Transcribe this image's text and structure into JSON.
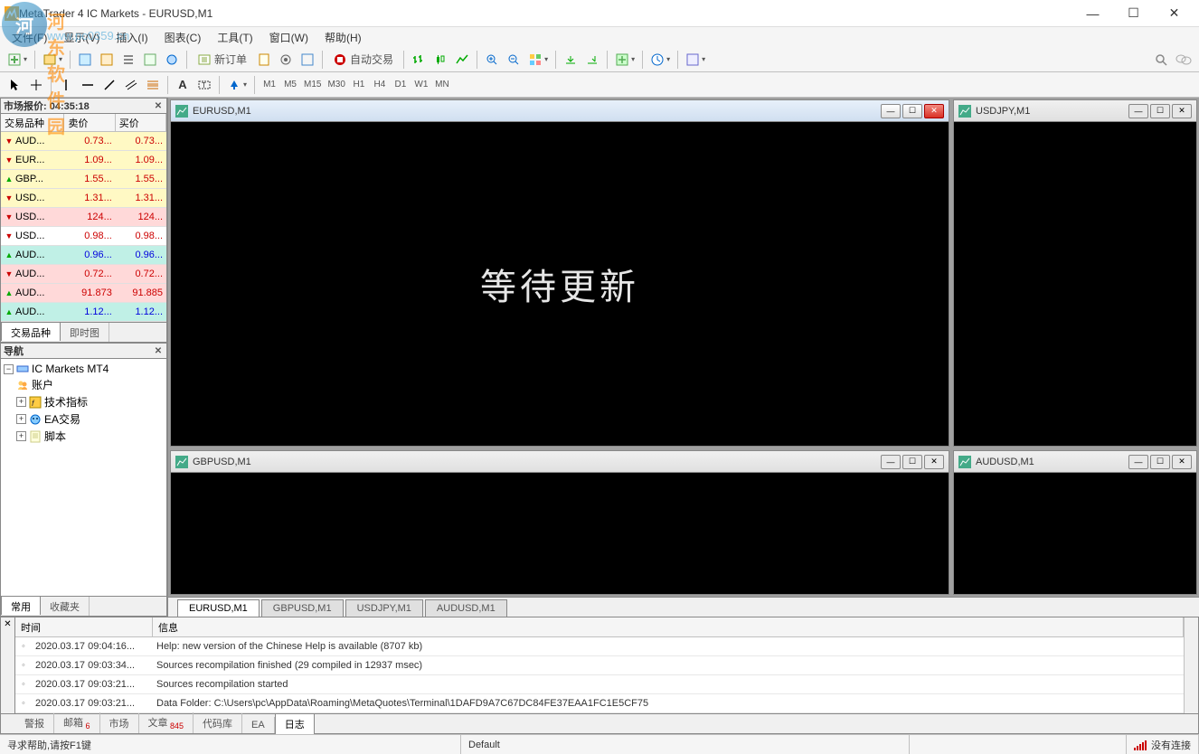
{
  "window": {
    "title": "MetaTrader 4 IC Markets - EURUSD,M1"
  },
  "watermark": {
    "logo_text": "河",
    "line1": "河东软件园",
    "line2": "www.pc0359.cn"
  },
  "menubar": [
    "文件(F)",
    "显示(V)",
    "插入(I)",
    "图表(C)",
    "工具(T)",
    "窗口(W)",
    "帮助(H)"
  ],
  "toolbar1": {
    "new_order": "新订单",
    "auto_trade": "自动交易"
  },
  "timeframes": [
    "M1",
    "M5",
    "M15",
    "M30",
    "H1",
    "H4",
    "D1",
    "W1",
    "MN"
  ],
  "market_watch": {
    "title": "市场报价: 04:35:18",
    "headers": [
      "交易品种",
      "卖价",
      "买价"
    ],
    "rows": [
      {
        "icon": "down",
        "sym": "AUD...",
        "bid": "0.73...",
        "ask": "0.73...",
        "bg": "yellow",
        "fg": "red"
      },
      {
        "icon": "down",
        "sym": "EUR...",
        "bid": "1.09...",
        "ask": "1.09...",
        "bg": "yellow",
        "fg": "red"
      },
      {
        "icon": "up",
        "sym": "GBP...",
        "bid": "1.55...",
        "ask": "1.55...",
        "bg": "yellow",
        "fg": "red"
      },
      {
        "icon": "down",
        "sym": "USD...",
        "bid": "1.31...",
        "ask": "1.31...",
        "bg": "yellow",
        "fg": "red"
      },
      {
        "icon": "down",
        "sym": "USD...",
        "bid": "124...",
        "ask": "124...",
        "bg": "pink",
        "fg": "red"
      },
      {
        "icon": "down",
        "sym": "USD...",
        "bid": "0.98...",
        "ask": "0.98...",
        "bg": "white",
        "fg": "red"
      },
      {
        "icon": "up",
        "sym": "AUD...",
        "bid": "0.96...",
        "ask": "0.96...",
        "bg": "cyan",
        "fg": "blue"
      },
      {
        "icon": "down",
        "sym": "AUD...",
        "bid": "0.72...",
        "ask": "0.72...",
        "bg": "pink",
        "fg": "red"
      },
      {
        "icon": "up",
        "sym": "AUD...",
        "bid": "91.873",
        "ask": "91.885",
        "bg": "pink",
        "fg": "red"
      },
      {
        "icon": "up",
        "sym": "AUD...",
        "bid": "1.12...",
        "ask": "1.12...",
        "bg": "cyan",
        "fg": "blue"
      }
    ],
    "tabs": [
      "交易品种",
      "即时图"
    ]
  },
  "navigator": {
    "title": "导航",
    "root": "IC Markets MT4",
    "items": [
      "账户",
      "技术指标",
      "EA交易",
      "脚本"
    ],
    "tabs": [
      "常用",
      "收藏夹"
    ]
  },
  "charts": {
    "placeholder": "等待更新",
    "windows": [
      {
        "title": "EURUSD,M1",
        "active": true,
        "show_placeholder": true
      },
      {
        "title": "USDJPY,M1",
        "active": false,
        "show_placeholder": false
      },
      {
        "title": "GBPUSD,M1",
        "active": false,
        "show_placeholder": false
      },
      {
        "title": "AUDUSD,M1",
        "active": false,
        "show_placeholder": false
      }
    ],
    "tabs": [
      "EURUSD,M1",
      "GBPUSD,M1",
      "USDJPY,M1",
      "AUDUSD,M1"
    ]
  },
  "terminal": {
    "headers": [
      "时间",
      "信息"
    ],
    "rows": [
      {
        "time": "2020.03.17 09:04:16...",
        "msg": "Help: new version of the Chinese Help is available (8707 kb)"
      },
      {
        "time": "2020.03.17 09:03:34...",
        "msg": "Sources recompilation finished (29 compiled in 12937 msec)"
      },
      {
        "time": "2020.03.17 09:03:21...",
        "msg": "Sources recompilation started"
      },
      {
        "time": "2020.03.17 09:03:21...",
        "msg": "Data Folder: C:\\Users\\pc\\AppData\\Roaming\\MetaQuotes\\Terminal\\1DAFD9A7C67DC84FE37EAA1FC1E5CF75"
      }
    ],
    "tabs": [
      {
        "label": "警报",
        "count": ""
      },
      {
        "label": "邮箱",
        "count": "6"
      },
      {
        "label": "市场",
        "count": ""
      },
      {
        "label": "文章",
        "count": "845"
      },
      {
        "label": "代码库",
        "count": ""
      },
      {
        "label": "EA",
        "count": ""
      },
      {
        "label": "日志",
        "count": ""
      }
    ],
    "active_tab": 6
  },
  "statusbar": {
    "help": "寻求帮助,请按F1键",
    "profile": "Default",
    "connection": "没有连接"
  }
}
